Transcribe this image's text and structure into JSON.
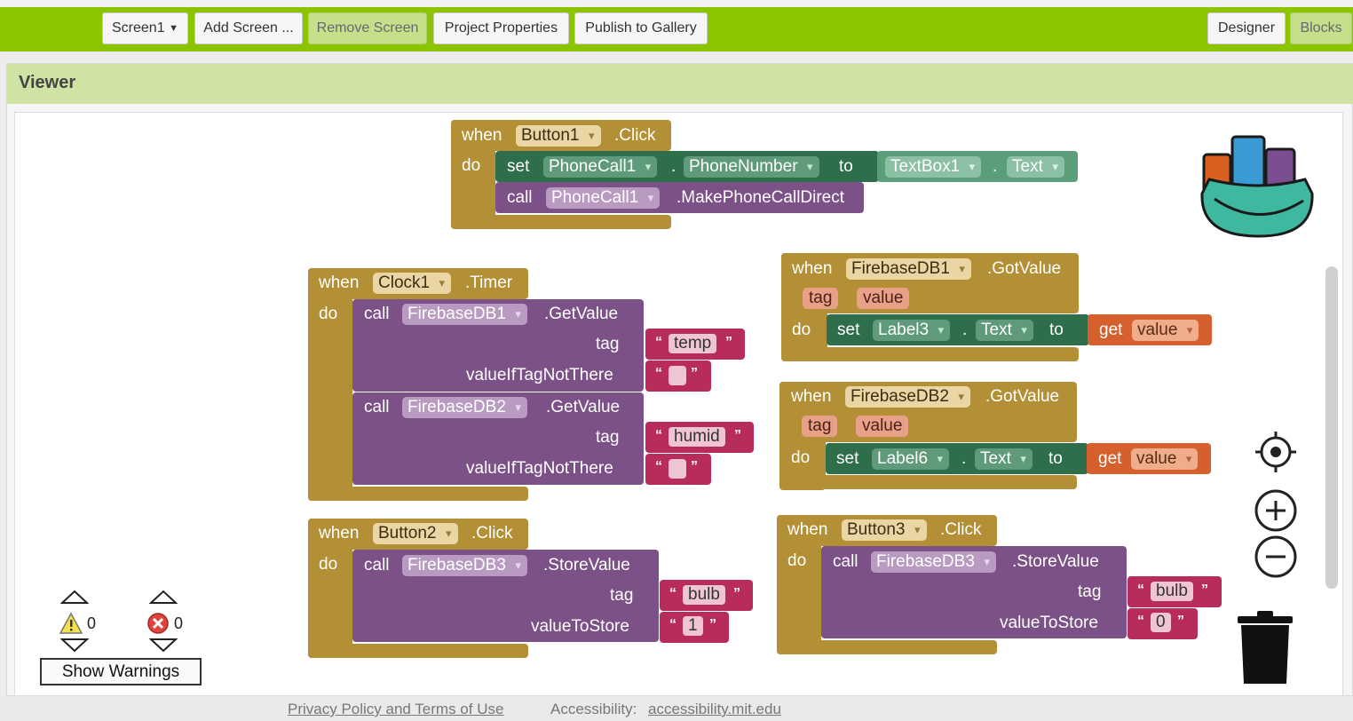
{
  "toolbar": {
    "screen_selector": "Screen1",
    "add_screen": "Add Screen ...",
    "remove_screen": "Remove Screen",
    "project_properties": "Project Properties",
    "publish": "Publish to Gallery",
    "designer": "Designer",
    "blocks": "Blocks"
  },
  "viewer": {
    "title": "Viewer"
  },
  "blocks": {
    "when": "when",
    "do": "do",
    "set": "set",
    "call": "call",
    "to": "to",
    "get": "get",
    "dot": ".",
    "tag": "tag",
    "value": "value",
    "valueIfTagNotThere": "valueIfTagNotThere",
    "valueToStore": "valueToStore",
    "b1": {
      "component": "Button1",
      "event": ".Click",
      "set_comp": "PhoneCall1",
      "set_prop": "PhoneNumber",
      "get_comp": "TextBox1",
      "get_prop": "Text",
      "call_comp": "PhoneCall1",
      "call_method": ".MakePhoneCallDirect"
    },
    "clock": {
      "component": "Clock1",
      "event": ".Timer",
      "call1_comp": "FirebaseDB1",
      "call1_method": ".GetValue",
      "tag1": "temp",
      "call2_comp": "FirebaseDB2",
      "call2_method": ".GetValue",
      "tag2": "humid"
    },
    "fb1": {
      "component": "FirebaseDB1",
      "event": ".GotValue",
      "set_comp": "Label3",
      "set_prop": "Text"
    },
    "fb2": {
      "component": "FirebaseDB2",
      "event": ".GotValue",
      "set_comp": "Label6",
      "set_prop": "Text"
    },
    "b2": {
      "component": "Button2",
      "event": ".Click",
      "call_comp": "FirebaseDB3",
      "call_method": ".StoreValue",
      "tag": "bulb",
      "store": "1"
    },
    "b3": {
      "component": "Button3",
      "event": ".Click",
      "call_comp": "FirebaseDB3",
      "call_method": ".StoreValue",
      "tag": "bulb",
      "store": "0"
    }
  },
  "warnings": {
    "warn_count": "0",
    "error_count": "0",
    "show_button": "Show Warnings"
  },
  "footer": {
    "privacy": "Privacy Policy and Terms of Use",
    "accessibility_label": "Accessibility:",
    "accessibility_link": "accessibility.mit.edu"
  },
  "colors": {
    "toolbar": "#8cc400",
    "event": "#b38f35",
    "procedure": "#7c5187",
    "setter": "#2e6e4b",
    "text": "#b82c5b",
    "lexical": "#d55f2d"
  }
}
